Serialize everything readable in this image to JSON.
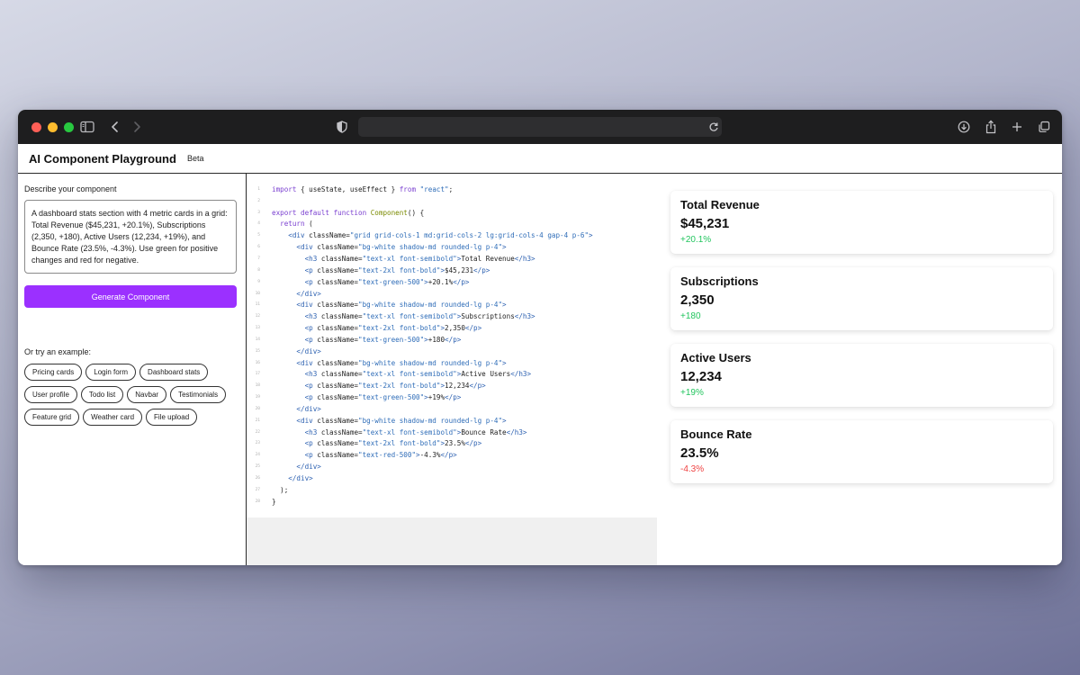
{
  "browser": {
    "url": ""
  },
  "app": {
    "title": "AI Component Playground",
    "badge": "Beta"
  },
  "left_panel": {
    "describe_label": "Describe your component",
    "prompt_text": "A dashboard stats section with 4 metric cards in a grid: Total Revenue ($45,231, +20.1%), Subscriptions (2,350, +180), Active Users (12,234, +19%), and Bounce Rate (23.5%, -4.3%). Use green for positive changes and red for negative.",
    "generate_label": "Generate Component",
    "examples_label": "Or try an example:",
    "examples": [
      "Pricing cards",
      "Login form",
      "Dashboard stats",
      "User profile",
      "Todo list",
      "Navbar",
      "Testimonials",
      "Feature grid",
      "Weather card",
      "File upload"
    ]
  },
  "code": {
    "lines": [
      [
        [
          "kw",
          "import"
        ],
        [
          "tx",
          " { useState, useEffect } "
        ],
        [
          "kw",
          "from"
        ],
        [
          "str",
          " \"react\""
        ],
        [
          "tx",
          ";"
        ]
      ],
      [],
      [
        [
          "kw",
          "export default function"
        ],
        [
          "fn",
          " Component"
        ],
        [
          "tx",
          "() {"
        ]
      ],
      [
        [
          "kw",
          "  return"
        ],
        [
          "tx",
          " ("
        ]
      ],
      [
        [
          "tag",
          "    <div"
        ],
        [
          "attr",
          " className="
        ],
        [
          "str",
          "\"grid grid-cols-1 md:grid-cols-2 lg:grid-cols-4 gap-4 p-6\""
        ],
        [
          "tag",
          ">"
        ]
      ],
      [
        [
          "tag",
          "      <div"
        ],
        [
          "attr",
          " className="
        ],
        [
          "str",
          "\"bg-white shadow-md rounded-lg p-4\""
        ],
        [
          "tag",
          ">"
        ]
      ],
      [
        [
          "tag",
          "        <h3"
        ],
        [
          "attr",
          " className="
        ],
        [
          "str",
          "\"text-xl font-semibold\""
        ],
        [
          "tag",
          ">"
        ],
        [
          "tx",
          "Total Revenue"
        ],
        [
          "tag",
          "</h3>"
        ]
      ],
      [
        [
          "tag",
          "        <p"
        ],
        [
          "attr",
          " className="
        ],
        [
          "str",
          "\"text-2xl font-bold\""
        ],
        [
          "tag",
          ">"
        ],
        [
          "tx",
          "$45,231"
        ],
        [
          "tag",
          "</p>"
        ]
      ],
      [
        [
          "tag",
          "        <p"
        ],
        [
          "attr",
          " className="
        ],
        [
          "str",
          "\"text-green-500\""
        ],
        [
          "tag",
          ">"
        ],
        [
          "tx",
          "+20.1%"
        ],
        [
          "tag",
          "</p>"
        ]
      ],
      [
        [
          "tag",
          "      </div>"
        ]
      ],
      [
        [
          "tag",
          "      <div"
        ],
        [
          "attr",
          " className="
        ],
        [
          "str",
          "\"bg-white shadow-md rounded-lg p-4\""
        ],
        [
          "tag",
          ">"
        ]
      ],
      [
        [
          "tag",
          "        <h3"
        ],
        [
          "attr",
          " className="
        ],
        [
          "str",
          "\"text-xl font-semibold\""
        ],
        [
          "tag",
          ">"
        ],
        [
          "tx",
          "Subscriptions"
        ],
        [
          "tag",
          "</h3>"
        ]
      ],
      [
        [
          "tag",
          "        <p"
        ],
        [
          "attr",
          " className="
        ],
        [
          "str",
          "\"text-2xl font-bold\""
        ],
        [
          "tag",
          ">"
        ],
        [
          "tx",
          "2,350"
        ],
        [
          "tag",
          "</p>"
        ]
      ],
      [
        [
          "tag",
          "        <p"
        ],
        [
          "attr",
          " className="
        ],
        [
          "str",
          "\"text-green-500\""
        ],
        [
          "tag",
          ">"
        ],
        [
          "tx",
          "+180"
        ],
        [
          "tag",
          "</p>"
        ]
      ],
      [
        [
          "tag",
          "      </div>"
        ]
      ],
      [
        [
          "tag",
          "      <div"
        ],
        [
          "attr",
          " className="
        ],
        [
          "str",
          "\"bg-white shadow-md rounded-lg p-4\""
        ],
        [
          "tag",
          ">"
        ]
      ],
      [
        [
          "tag",
          "        <h3"
        ],
        [
          "attr",
          " className="
        ],
        [
          "str",
          "\"text-xl font-semibold\""
        ],
        [
          "tag",
          ">"
        ],
        [
          "tx",
          "Active Users"
        ],
        [
          "tag",
          "</h3>"
        ]
      ],
      [
        [
          "tag",
          "        <p"
        ],
        [
          "attr",
          " className="
        ],
        [
          "str",
          "\"text-2xl font-bold\""
        ],
        [
          "tag",
          ">"
        ],
        [
          "tx",
          "12,234"
        ],
        [
          "tag",
          "</p>"
        ]
      ],
      [
        [
          "tag",
          "        <p"
        ],
        [
          "attr",
          " className="
        ],
        [
          "str",
          "\"text-green-500\""
        ],
        [
          "tag",
          ">"
        ],
        [
          "tx",
          "+19%"
        ],
        [
          "tag",
          "</p>"
        ]
      ],
      [
        [
          "tag",
          "      </div>"
        ]
      ],
      [
        [
          "tag",
          "      <div"
        ],
        [
          "attr",
          " className="
        ],
        [
          "str",
          "\"bg-white shadow-md rounded-lg p-4\""
        ],
        [
          "tag",
          ">"
        ]
      ],
      [
        [
          "tag",
          "        <h3"
        ],
        [
          "attr",
          " className="
        ],
        [
          "str",
          "\"text-xl font-semibold\""
        ],
        [
          "tag",
          ">"
        ],
        [
          "tx",
          "Bounce Rate"
        ],
        [
          "tag",
          "</h3>"
        ]
      ],
      [
        [
          "tag",
          "        <p"
        ],
        [
          "attr",
          " className="
        ],
        [
          "str",
          "\"text-2xl font-bold\""
        ],
        [
          "tag",
          ">"
        ],
        [
          "tx",
          "23.5%"
        ],
        [
          "tag",
          "</p>"
        ]
      ],
      [
        [
          "tag",
          "        <p"
        ],
        [
          "attr",
          " className="
        ],
        [
          "str",
          "\"text-red-500\""
        ],
        [
          "tag",
          ">"
        ],
        [
          "tx",
          "-4.3%"
        ],
        [
          "tag",
          "</p>"
        ]
      ],
      [
        [
          "tag",
          "      </div>"
        ]
      ],
      [
        [
          "tag",
          "    </div>"
        ]
      ],
      [
        [
          "tx",
          "  );"
        ]
      ],
      [
        [
          "tx",
          "}"
        ]
      ]
    ]
  },
  "preview": {
    "cards": [
      {
        "title": "Total Revenue",
        "value": "$45,231",
        "change": "+20.1%",
        "color": "#22c55e"
      },
      {
        "title": "Subscriptions",
        "value": "2,350",
        "change": "+180",
        "color": "#22c55e"
      },
      {
        "title": "Active Users",
        "value": "12,234",
        "change": "+19%",
        "color": "#22c55e"
      },
      {
        "title": "Bounce Rate",
        "value": "23.5%",
        "change": "-4.3%",
        "color": "#ef4444"
      }
    ]
  },
  "icons": {
    "sidebar": "sidebar-icon",
    "back": "chevron-left-icon",
    "forward": "chevron-right-icon",
    "shield": "shield-icon",
    "reload": "reload-icon",
    "download": "download-icon",
    "share": "share-icon",
    "new_tab": "plus-icon",
    "tabs": "tabs-overview-icon"
  }
}
